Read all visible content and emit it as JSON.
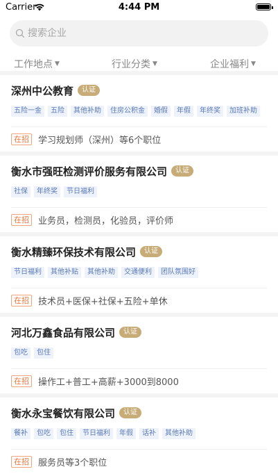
{
  "status_bar": {
    "carrier": "Carrier",
    "time": "4:44 PM"
  },
  "search": {
    "placeholder": "搜索企业"
  },
  "filters": [
    {
      "label": "工作地点"
    },
    {
      "label": "行业分类"
    },
    {
      "label": "企业福利"
    }
  ],
  "companies": [
    {
      "name": "深州中公教育",
      "badge": "认证",
      "tags": [
        "五险一金",
        "五险",
        "其他补助",
        "住房公积金",
        "婚假",
        "年假",
        "年终奖",
        "加班补助"
      ],
      "status": "在招",
      "jobs": "学习规划师（深州）等6个职位"
    },
    {
      "name": "衡水市强旺检测评价服务有限公司",
      "badge": "认证",
      "tags": [
        "社保",
        "年终奖",
        "节日福利"
      ],
      "status": "在招",
      "jobs": "业务员，检测员，化验员，评价师"
    },
    {
      "name": "衡水精臻环保技术有限公司",
      "badge": "认证",
      "tags": [
        "节日福利",
        "其他补贴",
        "其他补助",
        "交通便利",
        "团队氛围好"
      ],
      "status": "在招",
      "jobs": "技术员+医保+社保+五险+单休"
    },
    {
      "name": "河北万鑫食品有限公司",
      "badge": "认证",
      "tags": [
        "包吃",
        "包住"
      ],
      "status": "在招",
      "jobs": "操作工+普工+高薪+3000到8000"
    },
    {
      "name": "衡水永宝餐饮有限公司",
      "badge": "认证",
      "tags": [
        "餐补",
        "包吃",
        "包住",
        "节日福利",
        "年假",
        "话补",
        "其他补助"
      ],
      "status": "在招",
      "jobs": "服务员等3个职位"
    }
  ],
  "colors": {
    "badge": "#c8ac78",
    "tag_bg": "#eef2fa",
    "tag_text": "#5b7bb8",
    "hiring": "#e8743b"
  }
}
